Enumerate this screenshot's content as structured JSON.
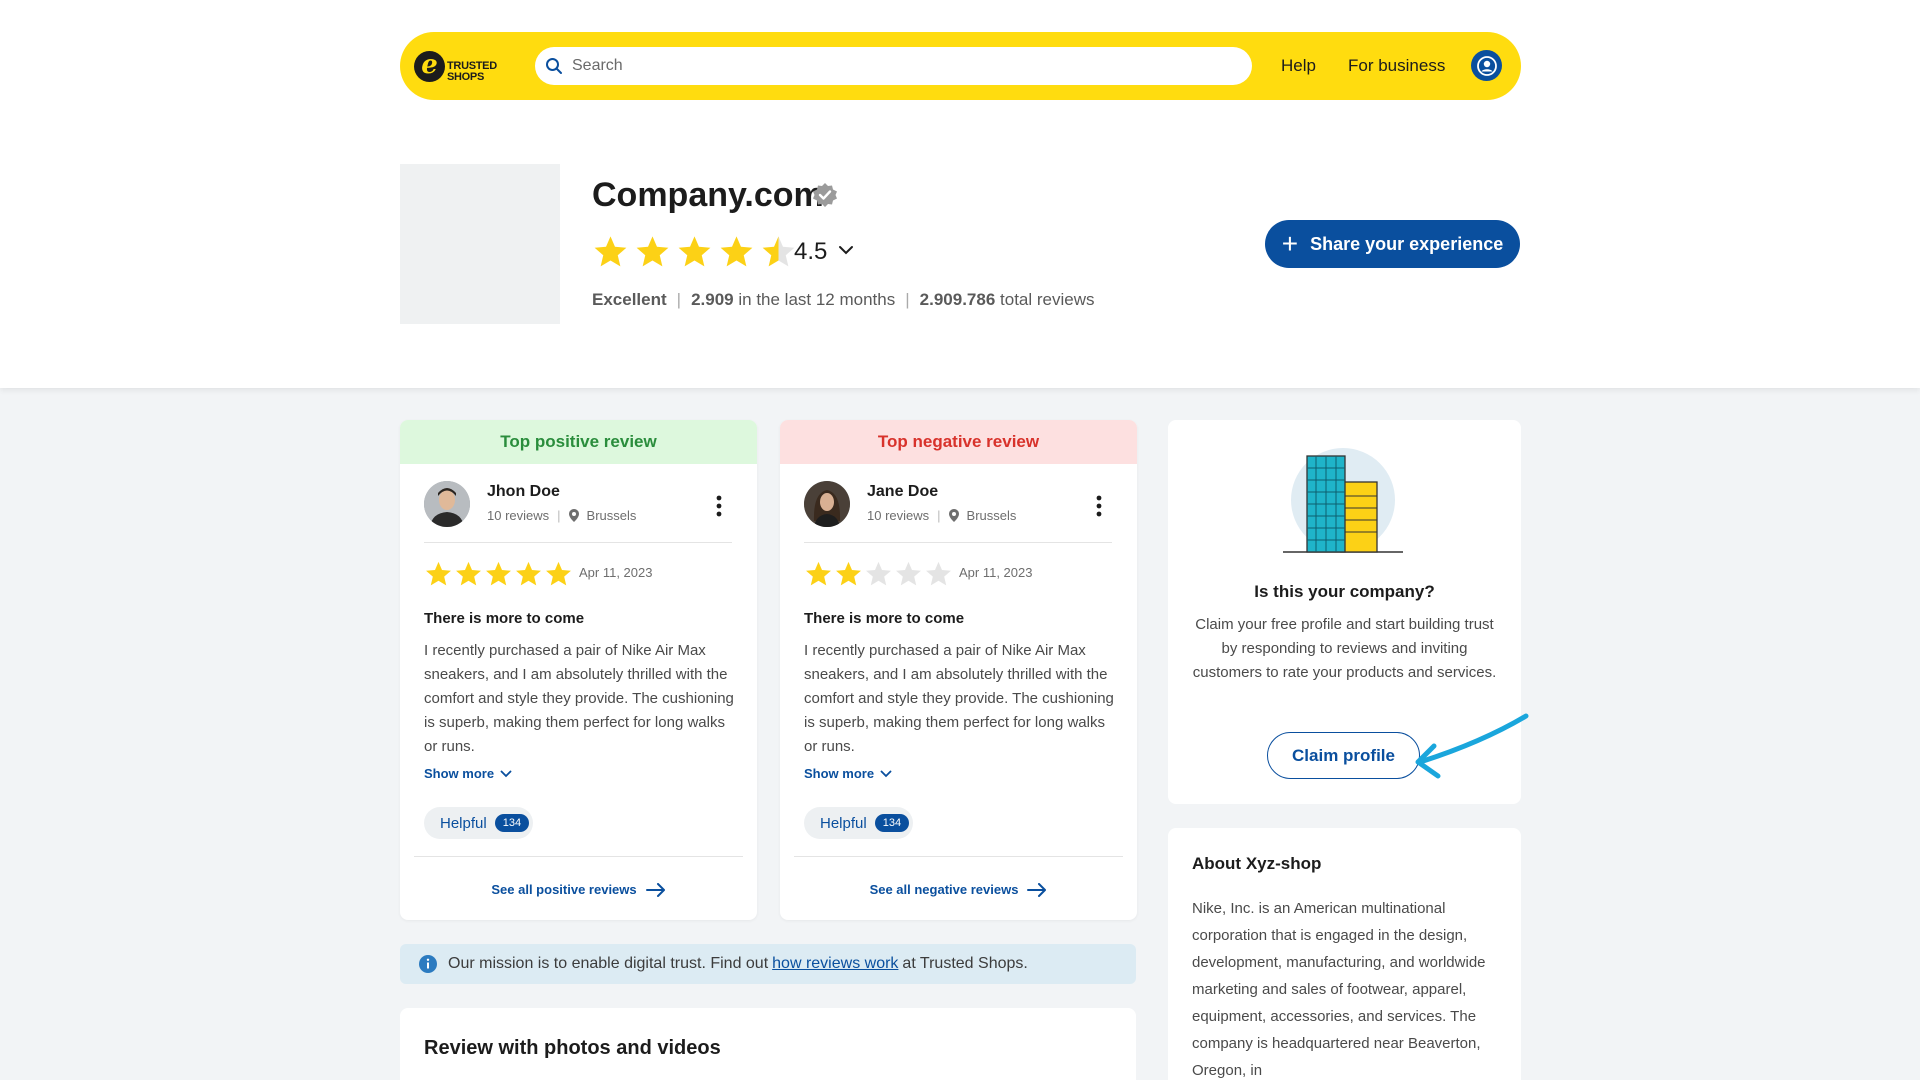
{
  "header": {
    "logo_text_line1": "TRUSTED",
    "logo_text_line2": "SHOPS",
    "logo_letter": "e",
    "search_placeholder": "Search",
    "nav": {
      "help": "Help",
      "for_business": "For business"
    }
  },
  "company": {
    "name": "Company.com",
    "rating": "4.5",
    "rating_fraction": 0.9,
    "label": "Excellent",
    "recent_count": "2.909",
    "recent_suffix": "in the last 12 months",
    "total_count": "2.909.786",
    "total_suffix": "total reviews",
    "share_button": "Share your experience"
  },
  "reviews": [
    {
      "heading": "Top positive review",
      "name": "Jhon Doe",
      "review_count": "10 reviews",
      "location": "Brussels",
      "stars": 5,
      "date": "Apr 11, 2023",
      "title": "There is more to come",
      "body": "I recently purchased a pair of Nike Air Max sneakers, and I am absolutely thrilled with the comfort and style they provide. The cushioning is superb, making them perfect for long walks or runs.",
      "show_more": "Show more",
      "helpful": "Helpful",
      "helpful_count": "134",
      "see_all": "See all positive reviews"
    },
    {
      "heading": "Top negative review",
      "name": "Jane Doe",
      "review_count": "10 reviews",
      "location": "Brussels",
      "stars": 2,
      "date": "Apr 11, 2023",
      "title": "There is more to come",
      "body": "I recently purchased a pair of Nike Air Max sneakers, and I am absolutely thrilled with the comfort and style they provide. The cushioning is superb, making them perfect for long walks or runs.",
      "show_more": "Show more",
      "helpful": "Helpful",
      "helpful_count": "134",
      "see_all": "See all negative reviews"
    }
  ],
  "claim": {
    "title": "Is this your company?",
    "text": "Claim your free profile and start building trust by responding to reviews and inviting customers to rate your products and services.",
    "button": "Claim profile"
  },
  "about": {
    "title": "About Xyz-shop",
    "text": "Nike, Inc. is an American multinational corporation that is engaged in the design, development, manufacturing, and worldwide marketing and sales of footwear, apparel, equipment, accessories, and services. The company is headquartered near Beaverton, Oregon, in"
  },
  "mission": {
    "before": "Our mission is to enable digital trust. Find out",
    "link": "how reviews work",
    "after": "at Trusted Shops."
  },
  "photos": {
    "title": "Review with photos and videos"
  },
  "colors": {
    "brand_yellow": "#ffdc0f",
    "primary_blue": "#0a4f9e",
    "star_yellow": "#fcd116",
    "positive_green": "#2a8d3c",
    "negative_red": "#d8322b"
  },
  "icons": [
    "search-icon",
    "user-icon",
    "verified-icon",
    "chevron-down-icon",
    "pin-icon",
    "kebab-icon",
    "arrow-right-icon",
    "info-icon",
    "building-icon"
  ]
}
